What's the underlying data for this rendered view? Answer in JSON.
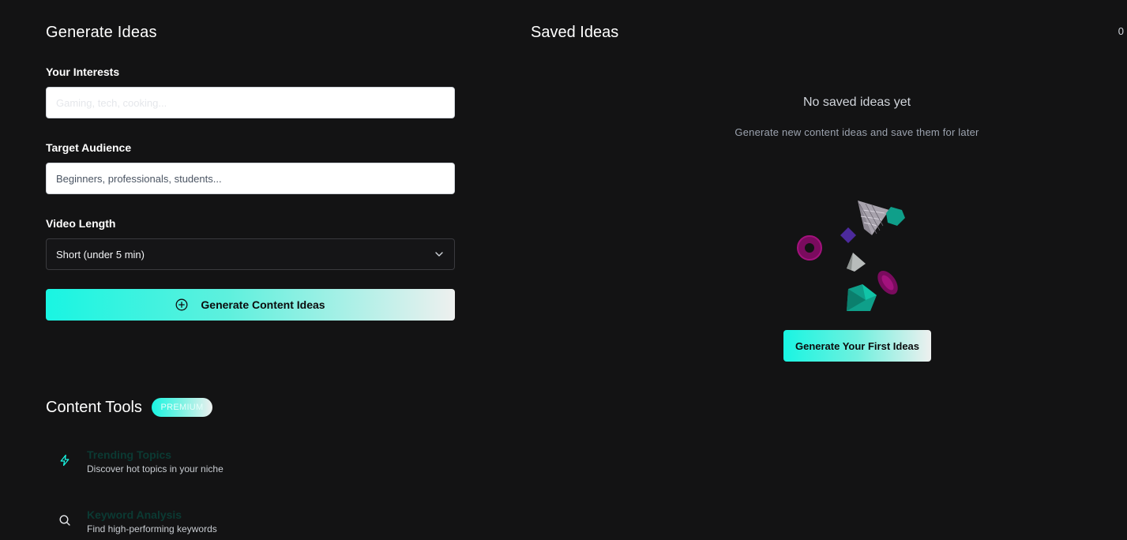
{
  "generator": {
    "title": "Generate Ideas",
    "interests_label": "Your Interests",
    "interests_placeholder": "Gaming, tech, cooking...",
    "audience_label": "Target Audience",
    "audience_placeholder": "Beginners, professionals, students...",
    "length_label": "Video Length",
    "length_selected": "Short (under 5 min)",
    "generate_button": "Generate Content Ideas"
  },
  "tools": {
    "title": "Content Tools",
    "badge": "PREMIUM",
    "items": [
      {
        "name": "Trending Topics",
        "description": "Discover hot topics in your niche",
        "icon": "bolt-icon"
      },
      {
        "name": "Keyword Analysis",
        "description": "Find high-performing keywords",
        "icon": "search-icon"
      }
    ]
  },
  "saved": {
    "title": "Saved Ideas",
    "count": "0",
    "empty_title": "No saved ideas yet",
    "empty_subtitle": "Generate new content ideas and save them for later",
    "first_button": "Generate Your First Ideas"
  },
  "colors": {
    "background": "#131314",
    "accent": "#19f5e2",
    "accent_end": "#eef0ef"
  }
}
